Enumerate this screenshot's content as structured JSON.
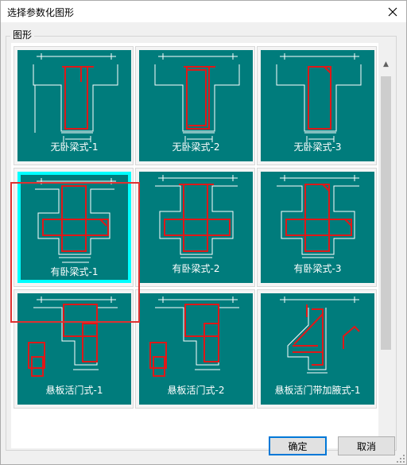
{
  "window": {
    "title": "选择参数化图形"
  },
  "group": {
    "label": "图形"
  },
  "tiles": [
    {
      "label": "无卧梁式-1",
      "icon": "beam-without-lintel-1-diagram"
    },
    {
      "label": "无卧梁式-2",
      "icon": "beam-without-lintel-2-diagram"
    },
    {
      "label": "无卧梁式-3",
      "icon": "beam-without-lintel-3-diagram"
    },
    {
      "label": "有卧梁式-1",
      "icon": "beam-with-lintel-1-diagram",
      "selected": true
    },
    {
      "label": "有卧梁式-2",
      "icon": "beam-with-lintel-2-diagram"
    },
    {
      "label": "有卧梁式-3",
      "icon": "beam-with-lintel-3-diagram"
    },
    {
      "label": "悬板活门式-1",
      "icon": "cantilever-slab-door-1-diagram"
    },
    {
      "label": "悬板活门式-2",
      "icon": "cantilever-slab-door-2-diagram"
    },
    {
      "label": "悬板活门带加腋式-1",
      "icon": "cantilever-slab-door-haunch-1-diagram"
    }
  ],
  "buttons": {
    "ok": "确定",
    "cancel": "取消"
  },
  "colors": {
    "tile_bg": "#007c7c",
    "selected_border": "#00ffff",
    "rebar": "#e01818",
    "line": "#ffffff",
    "highlight": "#e03131"
  }
}
